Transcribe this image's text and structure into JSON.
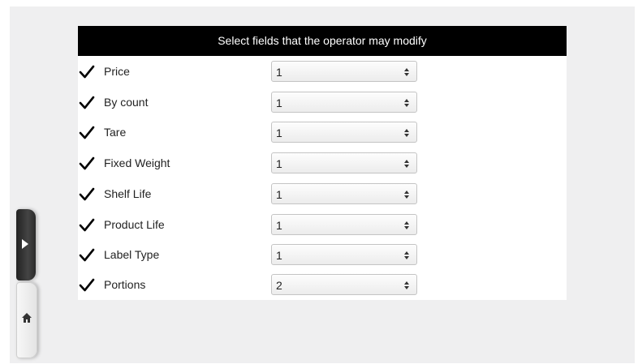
{
  "panel": {
    "header": "Select fields that the operator may modify"
  },
  "fields": [
    {
      "label": "Price",
      "checked": true,
      "value": "1"
    },
    {
      "label": "By count",
      "checked": true,
      "value": "1"
    },
    {
      "label": "Tare",
      "checked": true,
      "value": "1"
    },
    {
      "label": "Fixed Weight",
      "checked": true,
      "value": "1"
    },
    {
      "label": "Shelf Life",
      "checked": true,
      "value": "1"
    },
    {
      "label": "Product Life",
      "checked": true,
      "value": "1"
    },
    {
      "label": "Label Type",
      "checked": true,
      "value": "1"
    },
    {
      "label": "Portions",
      "checked": true,
      "value": "2"
    }
  ],
  "side_tabs": {
    "expand_icon": "play-arrow-icon",
    "home_icon": "home-icon"
  },
  "colors": {
    "header_bg": "#000000",
    "header_text": "#ffffff",
    "background": "#efeff0"
  }
}
